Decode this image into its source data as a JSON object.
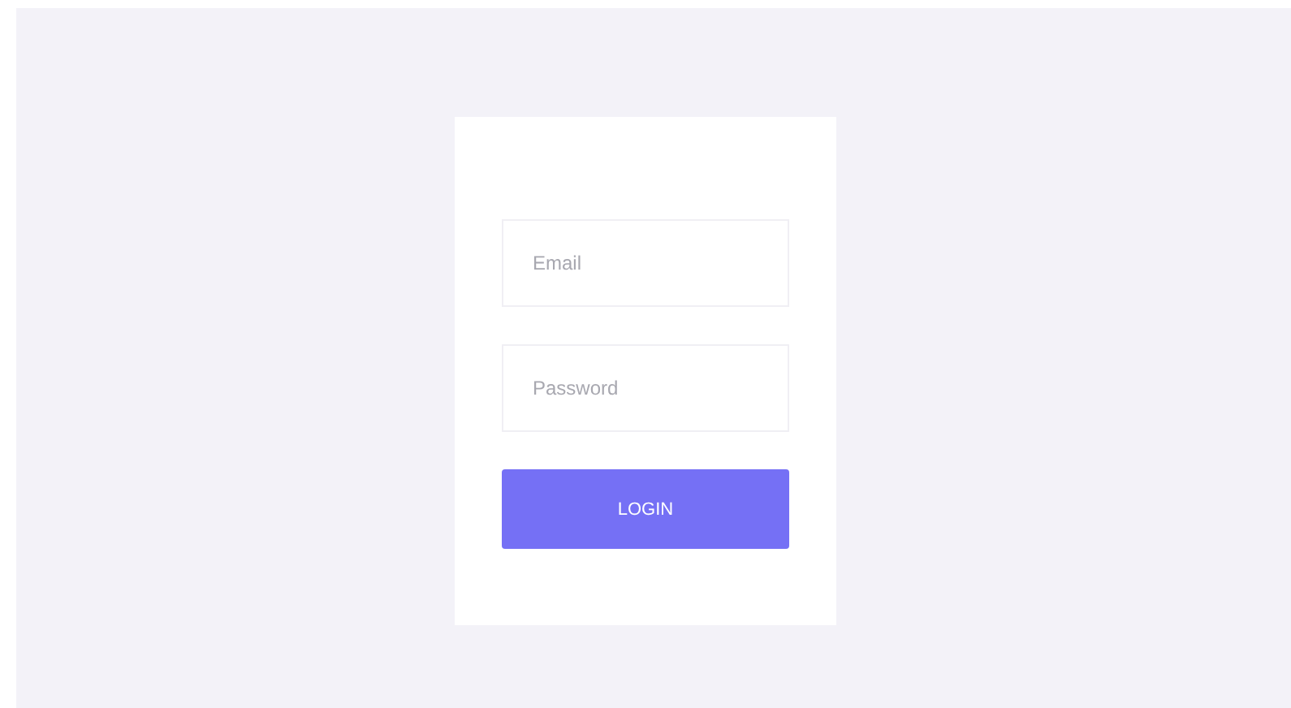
{
  "login_form": {
    "email": {
      "placeholder": "Email"
    },
    "password": {
      "placeholder": "Password"
    },
    "button": "LOGIN"
  }
}
